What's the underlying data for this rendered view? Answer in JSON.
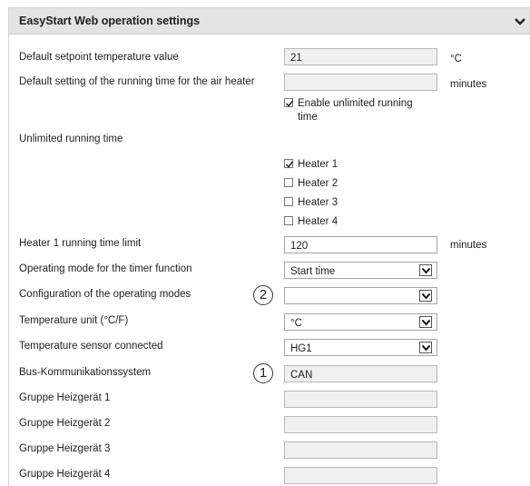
{
  "header": {
    "title": "EasyStart Web operation settings",
    "collapse_icon": "chevron-down-icon"
  },
  "rows": {
    "setpoint": {
      "label": "Default setpoint temperature value",
      "value": "21",
      "unit": "°C"
    },
    "runtime": {
      "label": "Default setting of the running time for the air heater",
      "value": "",
      "unit": "minutes",
      "checkbox_label_line1": "Enable unlimited running",
      "checkbox_label_line2": "time",
      "checkbox_checked": true
    },
    "unlimited": {
      "label": "Unlimited running time",
      "heaters": [
        {
          "label": "Heater 1",
          "checked": true
        },
        {
          "label": "Heater 2",
          "checked": false
        },
        {
          "label": "Heater 3",
          "checked": false
        },
        {
          "label": "Heater 4",
          "checked": false
        }
      ]
    },
    "limit": {
      "label": "Heater 1 running time limit",
      "value": "120",
      "unit": "minutes"
    },
    "timer_mode": {
      "label": "Operating mode for the timer function",
      "value": "Start time"
    },
    "config_modes": {
      "label": "Configuration of the operating modes",
      "value": "",
      "callout": "2"
    },
    "temp_unit": {
      "label": "Temperature unit (°C/F)",
      "value": "°C"
    },
    "sensor": {
      "label": "Temperature sensor connected",
      "value": "HG1"
    },
    "bus": {
      "label": "Bus-Kommunikationssystem",
      "value": "CAN",
      "callout": "1"
    },
    "group1": {
      "label": "Gruppe Heizgerät 1",
      "value": ""
    },
    "group2": {
      "label": "Gruppe Heizgerät 2",
      "value": ""
    },
    "group3": {
      "label": "Gruppe Heizgerät 3",
      "value": ""
    },
    "group4": {
      "label": "Gruppe Heizgerät 4",
      "value": ""
    }
  }
}
